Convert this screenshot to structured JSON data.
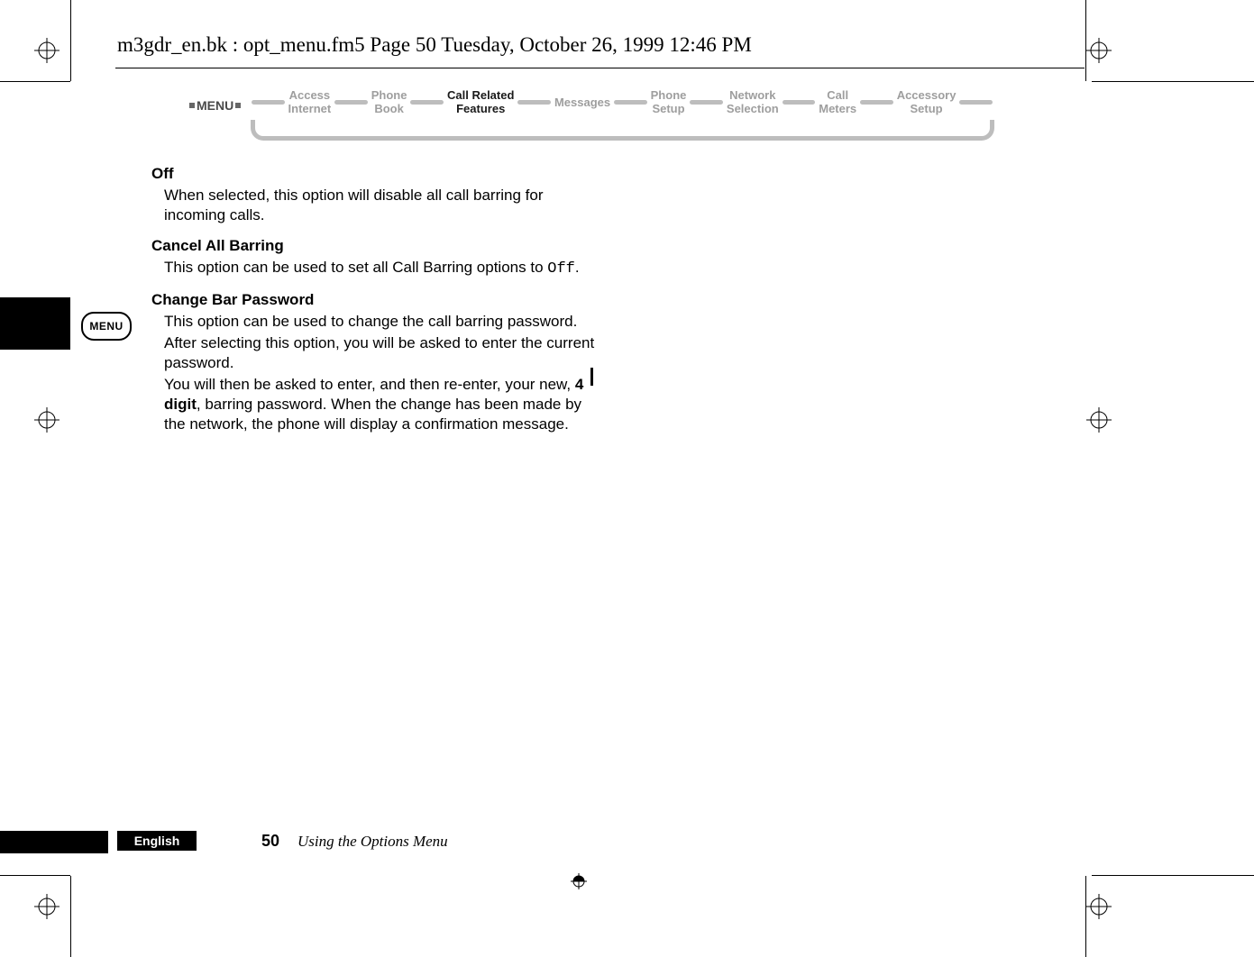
{
  "header": {
    "runhead": "m3gdr_en.bk : opt_menu.fm5  Page 50  Tuesday, October 26, 1999  12:46 PM"
  },
  "menu_ribbon": {
    "label": "MENU",
    "items": [
      {
        "line1": "Access",
        "line2": "Internet",
        "active": false
      },
      {
        "line1": "Phone",
        "line2": "Book",
        "active": false
      },
      {
        "line1": "Call Related",
        "line2": "Features",
        "active": true
      },
      {
        "line1": "Messages",
        "line2": "",
        "active": false
      },
      {
        "line1": "Phone",
        "line2": "Setup",
        "active": false
      },
      {
        "line1": "Network",
        "line2": "Selection",
        "active": false
      },
      {
        "line1": "Call",
        "line2": "Meters",
        "active": false
      },
      {
        "line1": "Accessory",
        "line2": "Setup",
        "active": false
      }
    ]
  },
  "sections": {
    "off": {
      "heading": "Off",
      "body": "When selected, this option will disable all call barring for incoming calls."
    },
    "cancel": {
      "heading": "Cancel All Barring",
      "body_pre": "This option can be used to set all Call Barring options to ",
      "code": "Off",
      "body_post": "."
    },
    "change": {
      "heading": "Change Bar Password",
      "p1": "This option can be used to change the call barring password.",
      "p2": "After selecting this option, you will be asked to enter the current password.",
      "p3_pre": "You will then be asked to enter, and then re-enter, your new, ",
      "p3_bold": "4 digit",
      "p3_post": ", barring password. When the change has been made by the network, the phone will display a confirmation message."
    }
  },
  "side_badge": {
    "label": "MENU"
  },
  "footer": {
    "language": "English",
    "page": "50",
    "title": "Using the Options Menu"
  }
}
